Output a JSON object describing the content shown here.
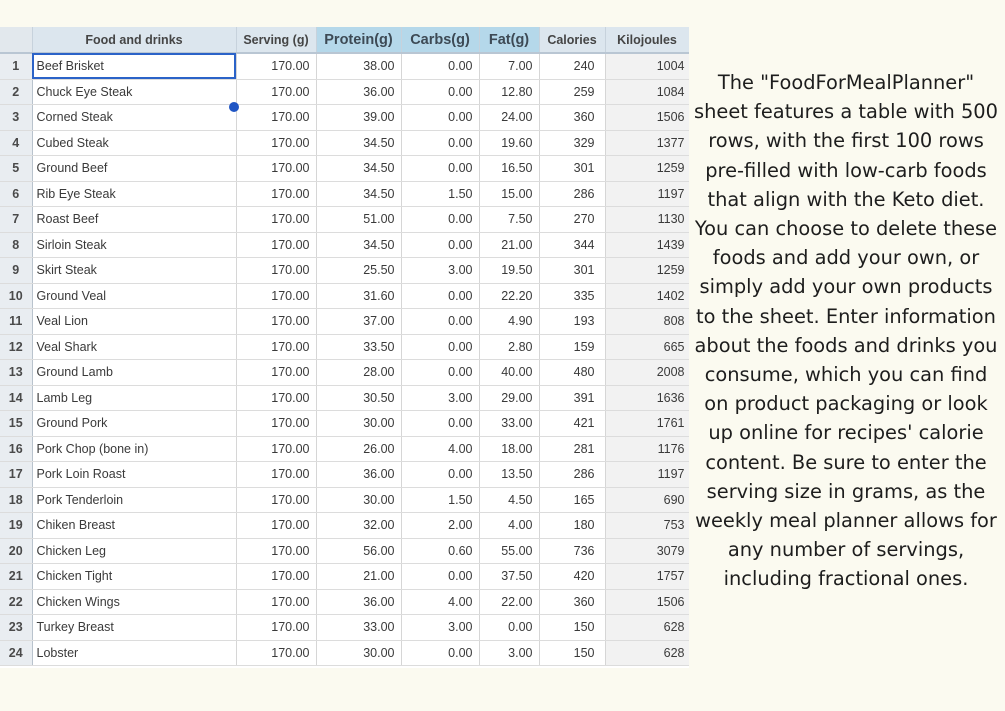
{
  "table": {
    "headers": {
      "food": "Food and drinks",
      "serving": "Serving (g)",
      "protein": "Protein(g)",
      "carbs": "Carbs(g)",
      "fat": "Fat(g)",
      "calories": "Calories",
      "kilojoules": "Kilojoules"
    },
    "rows": [
      {
        "n": "1",
        "food": "Beef Brisket",
        "serving": "170.00",
        "protein": "38.00",
        "carbs": "0.00",
        "fat": "7.00",
        "calories": "240",
        "kj": "1004"
      },
      {
        "n": "2",
        "food": "Chuck Eye Steak",
        "serving": "170.00",
        "protein": "36.00",
        "carbs": "0.00",
        "fat": "12.80",
        "calories": "259",
        "kj": "1084"
      },
      {
        "n": "3",
        "food": "Corned Steak",
        "serving": "170.00",
        "protein": "39.00",
        "carbs": "0.00",
        "fat": "24.00",
        "calories": "360",
        "kj": "1506"
      },
      {
        "n": "4",
        "food": "Cubed Steak",
        "serving": "170.00",
        "protein": "34.50",
        "carbs": "0.00",
        "fat": "19.60",
        "calories": "329",
        "kj": "1377"
      },
      {
        "n": "5",
        "food": "Ground Beef",
        "serving": "170.00",
        "protein": "34.50",
        "carbs": "0.00",
        "fat": "16.50",
        "calories": "301",
        "kj": "1259"
      },
      {
        "n": "6",
        "food": "Rib Eye Steak",
        "serving": "170.00",
        "protein": "34.50",
        "carbs": "1.50",
        "fat": "15.00",
        "calories": "286",
        "kj": "1197"
      },
      {
        "n": "7",
        "food": "Roast Beef",
        "serving": "170.00",
        "protein": "51.00",
        "carbs": "0.00",
        "fat": "7.50",
        "calories": "270",
        "kj": "1130"
      },
      {
        "n": "8",
        "food": "Sirloin Steak",
        "serving": "170.00",
        "protein": "34.50",
        "carbs": "0.00",
        "fat": "21.00",
        "calories": "344",
        "kj": "1439"
      },
      {
        "n": "9",
        "food": "Skirt Steak",
        "serving": "170.00",
        "protein": "25.50",
        "carbs": "3.00",
        "fat": "19.50",
        "calories": "301",
        "kj": "1259"
      },
      {
        "n": "10",
        "food": "Ground Veal",
        "serving": "170.00",
        "protein": "31.60",
        "carbs": "0.00",
        "fat": "22.20",
        "calories": "335",
        "kj": "1402"
      },
      {
        "n": "11",
        "food": "Veal Lion",
        "serving": "170.00",
        "protein": "37.00",
        "carbs": "0.00",
        "fat": "4.90",
        "calories": "193",
        "kj": "808"
      },
      {
        "n": "12",
        "food": "Veal Shark",
        "serving": "170.00",
        "protein": "33.50",
        "carbs": "0.00",
        "fat": "2.80",
        "calories": "159",
        "kj": "665"
      },
      {
        "n": "13",
        "food": "Ground Lamb",
        "serving": "170.00",
        "protein": "28.00",
        "carbs": "0.00",
        "fat": "40.00",
        "calories": "480",
        "kj": "2008"
      },
      {
        "n": "14",
        "food": "Lamb Leg",
        "serving": "170.00",
        "protein": "30.50",
        "carbs": "3.00",
        "fat": "29.00",
        "calories": "391",
        "kj": "1636"
      },
      {
        "n": "15",
        "food": "Ground Pork",
        "serving": "170.00",
        "protein": "30.00",
        "carbs": "0.00",
        "fat": "33.00",
        "calories": "421",
        "kj": "1761"
      },
      {
        "n": "16",
        "food": "Pork Chop (bone in)",
        "serving": "170.00",
        "protein": "26.00",
        "carbs": "4.00",
        "fat": "18.00",
        "calories": "281",
        "kj": "1176"
      },
      {
        "n": "17",
        "food": "Pork Loin Roast",
        "serving": "170.00",
        "protein": "36.00",
        "carbs": "0.00",
        "fat": "13.50",
        "calories": "286",
        "kj": "1197"
      },
      {
        "n": "18",
        "food": "Pork Tenderloin",
        "serving": "170.00",
        "protein": "30.00",
        "carbs": "1.50",
        "fat": "4.50",
        "calories": "165",
        "kj": "690"
      },
      {
        "n": "19",
        "food": "Chiken Breast",
        "serving": "170.00",
        "protein": "32.00",
        "carbs": "2.00",
        "fat": "4.00",
        "calories": "180",
        "kj": "753"
      },
      {
        "n": "20",
        "food": "Chicken Leg",
        "serving": "170.00",
        "protein": "56.00",
        "carbs": "0.60",
        "fat": "55.00",
        "calories": "736",
        "kj": "3079"
      },
      {
        "n": "21",
        "food": "Chicken Tight",
        "serving": "170.00",
        "protein": "21.00",
        "carbs": "0.00",
        "fat": "37.50",
        "calories": "420",
        "kj": "1757"
      },
      {
        "n": "22",
        "food": "Chicken Wings",
        "serving": "170.00",
        "protein": "36.00",
        "carbs": "4.00",
        "fat": "22.00",
        "calories": "360",
        "kj": "1506"
      },
      {
        "n": "23",
        "food": "Turkey Breast",
        "serving": "170.00",
        "protein": "33.00",
        "carbs": "3.00",
        "fat": "0.00",
        "calories": "150",
        "kj": "628"
      },
      {
        "n": "24",
        "food": "Lobster",
        "serving": "170.00",
        "protein": "30.00",
        "carbs": "0.00",
        "fat": "3.00",
        "calories": "150",
        "kj": "628"
      }
    ]
  },
  "description": "The \"FoodForMealPlanner\" sheet features a table with 500 rows, with the first 100 rows pre-filled with low-carb foods that align with the Keto diet. You can choose to delete these foods and add your own, or simply add your own products to the sheet. Enter information about the foods and drinks you consume, which you can find on product packaging or look up online for recipes' calorie content. Be sure to enter the serving size in grams, as the weekly meal planner allows for any number of servings, including fractional ones."
}
